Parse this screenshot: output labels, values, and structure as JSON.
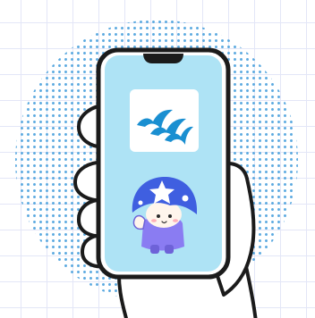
{
  "illustration": {
    "subject": "hand-holding-phone",
    "app_icon": "three-blue-birds-icon",
    "mascot": "star-cap-mascot"
  },
  "colors": {
    "grid_line": "#e3e6f7",
    "dot": "#5aa9e0",
    "phone_screen": "#aee3f5",
    "outline": "#1b1b1b",
    "bird_blue": "#1a8fd1",
    "mascot_cap": "#3f5fe0",
    "mascot_shirt": "#8a7cf2",
    "skin": "#fff5ec"
  }
}
